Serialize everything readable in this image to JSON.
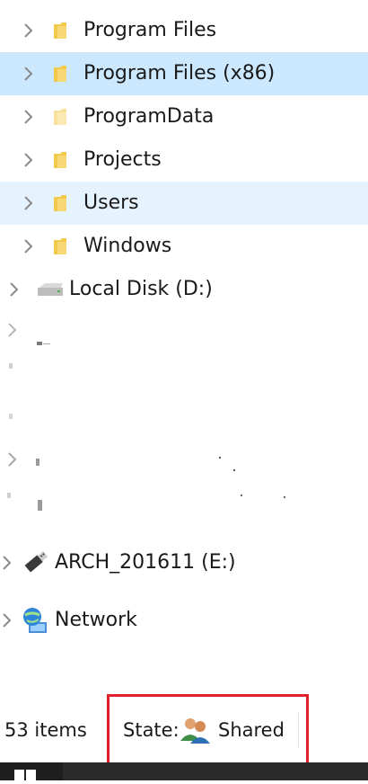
{
  "tree": {
    "folders": [
      {
        "label": "Program Files"
      },
      {
        "label": "Program Files (x86)"
      },
      {
        "label": "ProgramData"
      },
      {
        "label": "Projects"
      },
      {
        "label": "Users"
      },
      {
        "label": "Windows"
      }
    ],
    "drives": [
      {
        "label": "Local Disk (D:)",
        "icon": "hard-drive-icon"
      },
      {
        "label": "ARCH_201611 (E:)",
        "icon": "usb-drive-icon"
      },
      {
        "label": "Network",
        "icon": "network-icon"
      }
    ]
  },
  "status_bar": {
    "item_count": "53 items",
    "state_label": "State:",
    "state_value": "Shared"
  },
  "colors": {
    "selected_row": "#cce8ff",
    "hover_row": "#e5f3ff",
    "highlight_box": "#e0202a",
    "folder": "#f8d775"
  }
}
